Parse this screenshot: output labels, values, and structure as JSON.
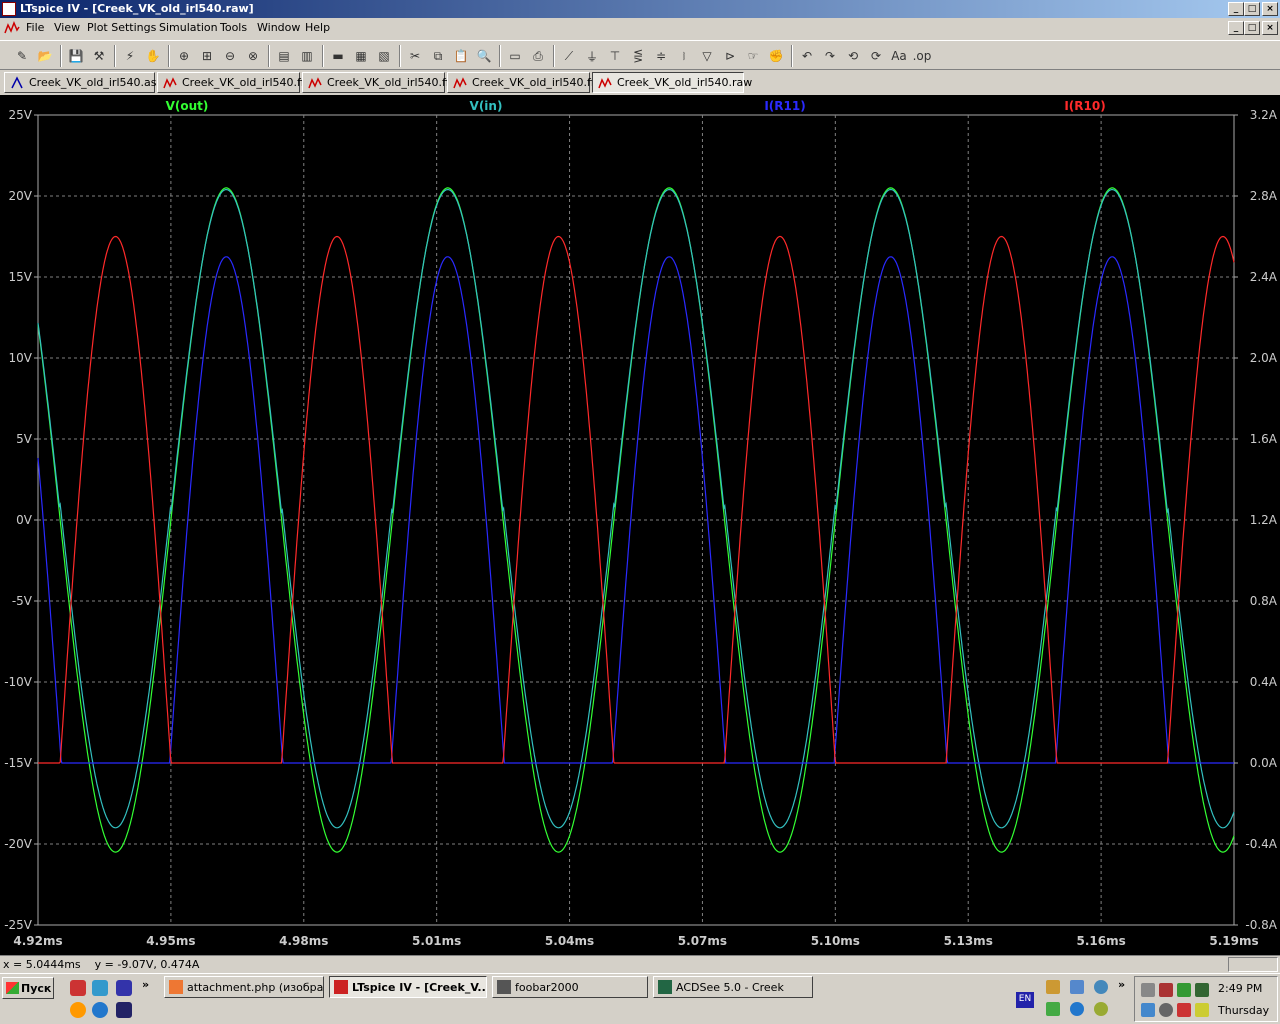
{
  "window": {
    "title": "LTspice IV - [Creek_VK_old_irl540.raw]"
  },
  "menu": [
    "File",
    "View",
    "Plot Settings",
    "Simulation",
    "Tools",
    "Window",
    "Help"
  ],
  "toolbar": {
    "icons": [
      "new-schematic",
      "open",
      "save",
      "control-panel",
      "run",
      "halt",
      "zoom-in",
      "zoom-box",
      "zoom-out",
      "zoom-cancel",
      "autorange",
      "vertical-autorange",
      "tile-horizontal",
      "cascade",
      "tile-vertical",
      "cut",
      "copy",
      "paste",
      "find",
      "print-preview",
      "print",
      "wire",
      "ground",
      "label",
      "resistor",
      "capacitor",
      "inductor",
      "diode",
      "component",
      "move",
      "drag",
      "undo",
      "redo",
      "rotate",
      "mirror",
      "text",
      "spice-directive"
    ]
  },
  "tabs": [
    {
      "label": "Creek_VK_old_irl540.asc",
      "icon": "schematic-icon"
    },
    {
      "label": "Creek_VK_old_irl540.fft",
      "icon": "waveform-icon"
    },
    {
      "label": "Creek_VK_old_irl540.fft",
      "icon": "waveform-icon"
    },
    {
      "label": "Creek_VK_old_irl540.fft",
      "icon": "waveform-icon"
    },
    {
      "label": "Creek_VK_old_irl540.raw",
      "icon": "waveform-icon",
      "active": true
    }
  ],
  "chart_data": {
    "type": "line",
    "title": "",
    "xlabel": "",
    "ylabel": "",
    "grid": true,
    "x_range": [
      4.92,
      5.19
    ],
    "x_unit": "ms",
    "y_left_range": [
      -25,
      25
    ],
    "y_right_range": [
      -0.8,
      3.2
    ],
    "x_ticks": [
      "4.92ms",
      "4.95ms",
      "4.98ms",
      "5.01ms",
      "5.04ms",
      "5.07ms",
      "5.10ms",
      "5.13ms",
      "5.16ms",
      "5.19ms"
    ],
    "y_left_ticks": [
      "25V",
      "20V",
      "15V",
      "10V",
      "5V",
      "0V",
      "-5V",
      "-10V",
      "-15V",
      "-20V",
      "-25V"
    ],
    "y_right_ticks": [
      "3.2A",
      "2.8A",
      "2.4A",
      "2.0A",
      "1.6A",
      "1.2A",
      "0.8A",
      "0.4A",
      "0.0A",
      "-0.4A",
      "-0.8A"
    ],
    "period_ms": 0.05,
    "series": [
      {
        "name": "V(out)",
        "axis": "left",
        "color": "#33ff33",
        "kind": "sine",
        "amplitude": 20.5,
        "peak_ms": 4.9625
      },
      {
        "name": "V(in)",
        "axis": "left",
        "color": "#33c0c0",
        "kind": "sine",
        "offset": 1,
        "amplitude": 20,
        "peak_ms": 4.9625
      },
      {
        "name": "I(R11)",
        "axis": "right",
        "color": "#2a2aff",
        "kind": "half-wave",
        "peak": 2.5,
        "peak_ms": 4.9625,
        "conduction_ms": 0.0255
      },
      {
        "name": "I(R10)",
        "axis": "right",
        "color": "#ff2a2a",
        "kind": "half-wave",
        "peak": 2.6,
        "peak_ms": 4.9375,
        "conduction_ms": 0.025
      }
    ]
  },
  "statusbar": {
    "text": "x = 5.0444ms    y = -9.07V, 0.474A"
  },
  "taskbar": {
    "start_label": "Пуск",
    "buttons": [
      {
        "label": "attachment.php (изобра...",
        "icon": "firefox-icon"
      },
      {
        "label": "LTspice IV - [Creek_V...",
        "icon": "ltspice-icon",
        "active": true
      },
      {
        "label": "foobar2000",
        "icon": "foobar-icon"
      },
      {
        "label": "ACDSee 5.0 - Creek",
        "icon": "acdsee-icon"
      }
    ],
    "lang": "EN",
    "time": "2:49 PM",
    "day": "Thursday"
  }
}
